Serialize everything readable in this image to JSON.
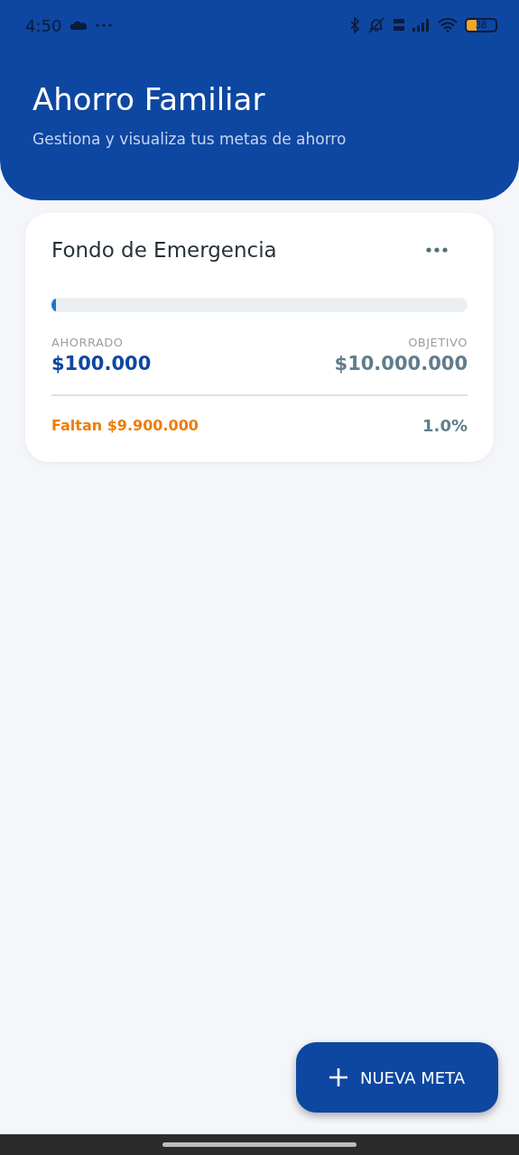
{
  "status_bar": {
    "time": "4:50",
    "battery": "38"
  },
  "header": {
    "title": "Ahorro Familiar",
    "subtitle": "Gestiona y visualiza tus metas de ahorro"
  },
  "goals": [
    {
      "name": "Fondo de Emergencia",
      "level": 0.01,
      "saved_label": "AHORRADO",
      "saved": "$100.000",
      "target_label": "OBJETIVO",
      "target": "$10.000.000",
      "remaining": "Faltan $9.900.000",
      "percent": "1.0%"
    }
  ],
  "fab": {
    "label": "NUEVA META"
  }
}
